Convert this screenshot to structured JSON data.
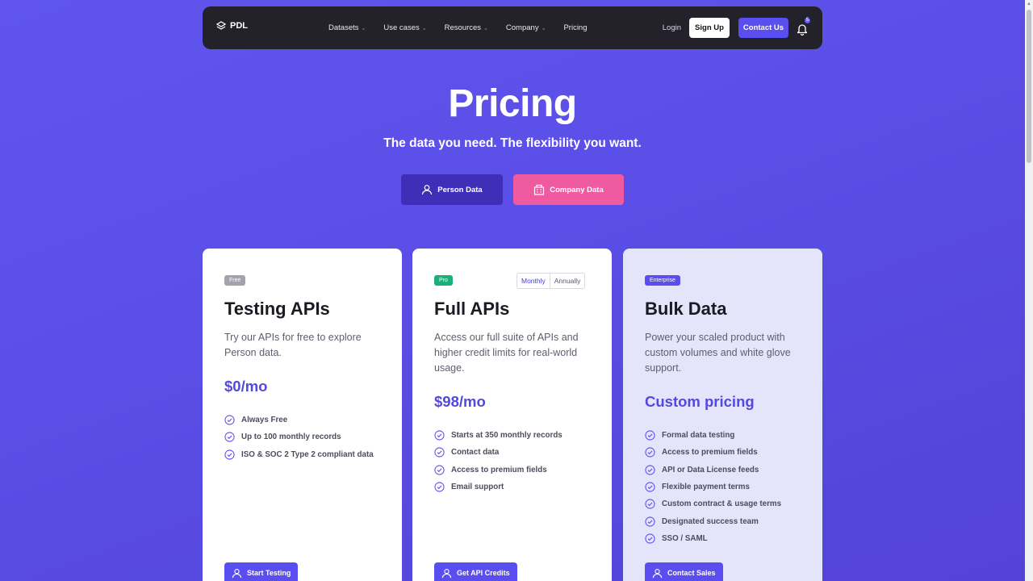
{
  "nav": {
    "brand": "PDL",
    "links": [
      {
        "label": "Datasets",
        "has_menu": true
      },
      {
        "label": "Use cases",
        "has_menu": true
      },
      {
        "label": "Resources",
        "has_menu": true
      },
      {
        "label": "Company",
        "has_menu": true
      },
      {
        "label": "Pricing",
        "has_menu": false
      }
    ],
    "login": "Login",
    "signup": "Sign Up",
    "contact": "Contact Us",
    "notifications_count": "5"
  },
  "hero": {
    "title": "Pricing",
    "subtitle": "The data you need. The flexibility you want.",
    "person_data": "Person Data",
    "company_data": "Company Data"
  },
  "plans": [
    {
      "badge": "Free",
      "title": "Testing APIs",
      "description": "Try our APIs for free to explore Person data.",
      "price": "$0/mo",
      "features": [
        "Always Free",
        "Up to 100 monthly records",
        "ISO & SOC 2 Type 2 compliant data"
      ],
      "cta": "Start Testing"
    },
    {
      "badge": "Pro",
      "title": "Full APIs",
      "description": "Access our full suite of APIs and higher credit limits for real-world usage.",
      "price": "$98/mo",
      "billing": {
        "monthly": "Monthly",
        "annually": "Annually",
        "selected": "Monthly"
      },
      "features": [
        "Starts at 350 monthly records",
        "Contact data",
        "Access to premium fields",
        "Email support"
      ],
      "cta": "Get API Credits"
    },
    {
      "badge": "Enterprise",
      "title": "Bulk Data",
      "description": "Power your scaled product with custom volumes and white glove support.",
      "price": "Custom pricing",
      "features": [
        "Formal data testing",
        "Access to premium fields",
        "API or Data License feeds",
        "Flexible payment terms",
        "Custom contract & usage terms",
        "Designated success team",
        "SSO / SAML"
      ],
      "cta": "Contact Sales"
    }
  ],
  "colors": {
    "background": "#5a4ee6",
    "accent": "#5b4ef0",
    "pink": "#ef5aa0",
    "pro_green": "#1ab07a",
    "nav_bg": "#23222b"
  }
}
